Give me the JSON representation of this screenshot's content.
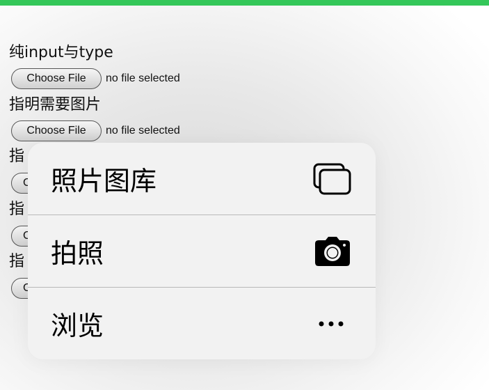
{
  "colors": {
    "top_bar": "#34c759",
    "menu_background": "#f2f2f2"
  },
  "sections": [
    {
      "label": "纯input与type",
      "button_label": "Choose File",
      "status": "no file selected"
    },
    {
      "label": "指明需要图片",
      "button_label": "Choose File",
      "status": "no file selected"
    },
    {
      "label": "指",
      "button_label": "C",
      "status": ""
    },
    {
      "label": "指",
      "button_label": "C",
      "status": ""
    },
    {
      "label": "指",
      "button_label": "C",
      "status": ""
    }
  ],
  "menu": {
    "items": [
      {
        "label": "照片图库",
        "icon": "photo-library-icon"
      },
      {
        "label": "拍照",
        "icon": "camera-icon"
      },
      {
        "label": "浏览",
        "icon": "more-icon"
      }
    ]
  }
}
